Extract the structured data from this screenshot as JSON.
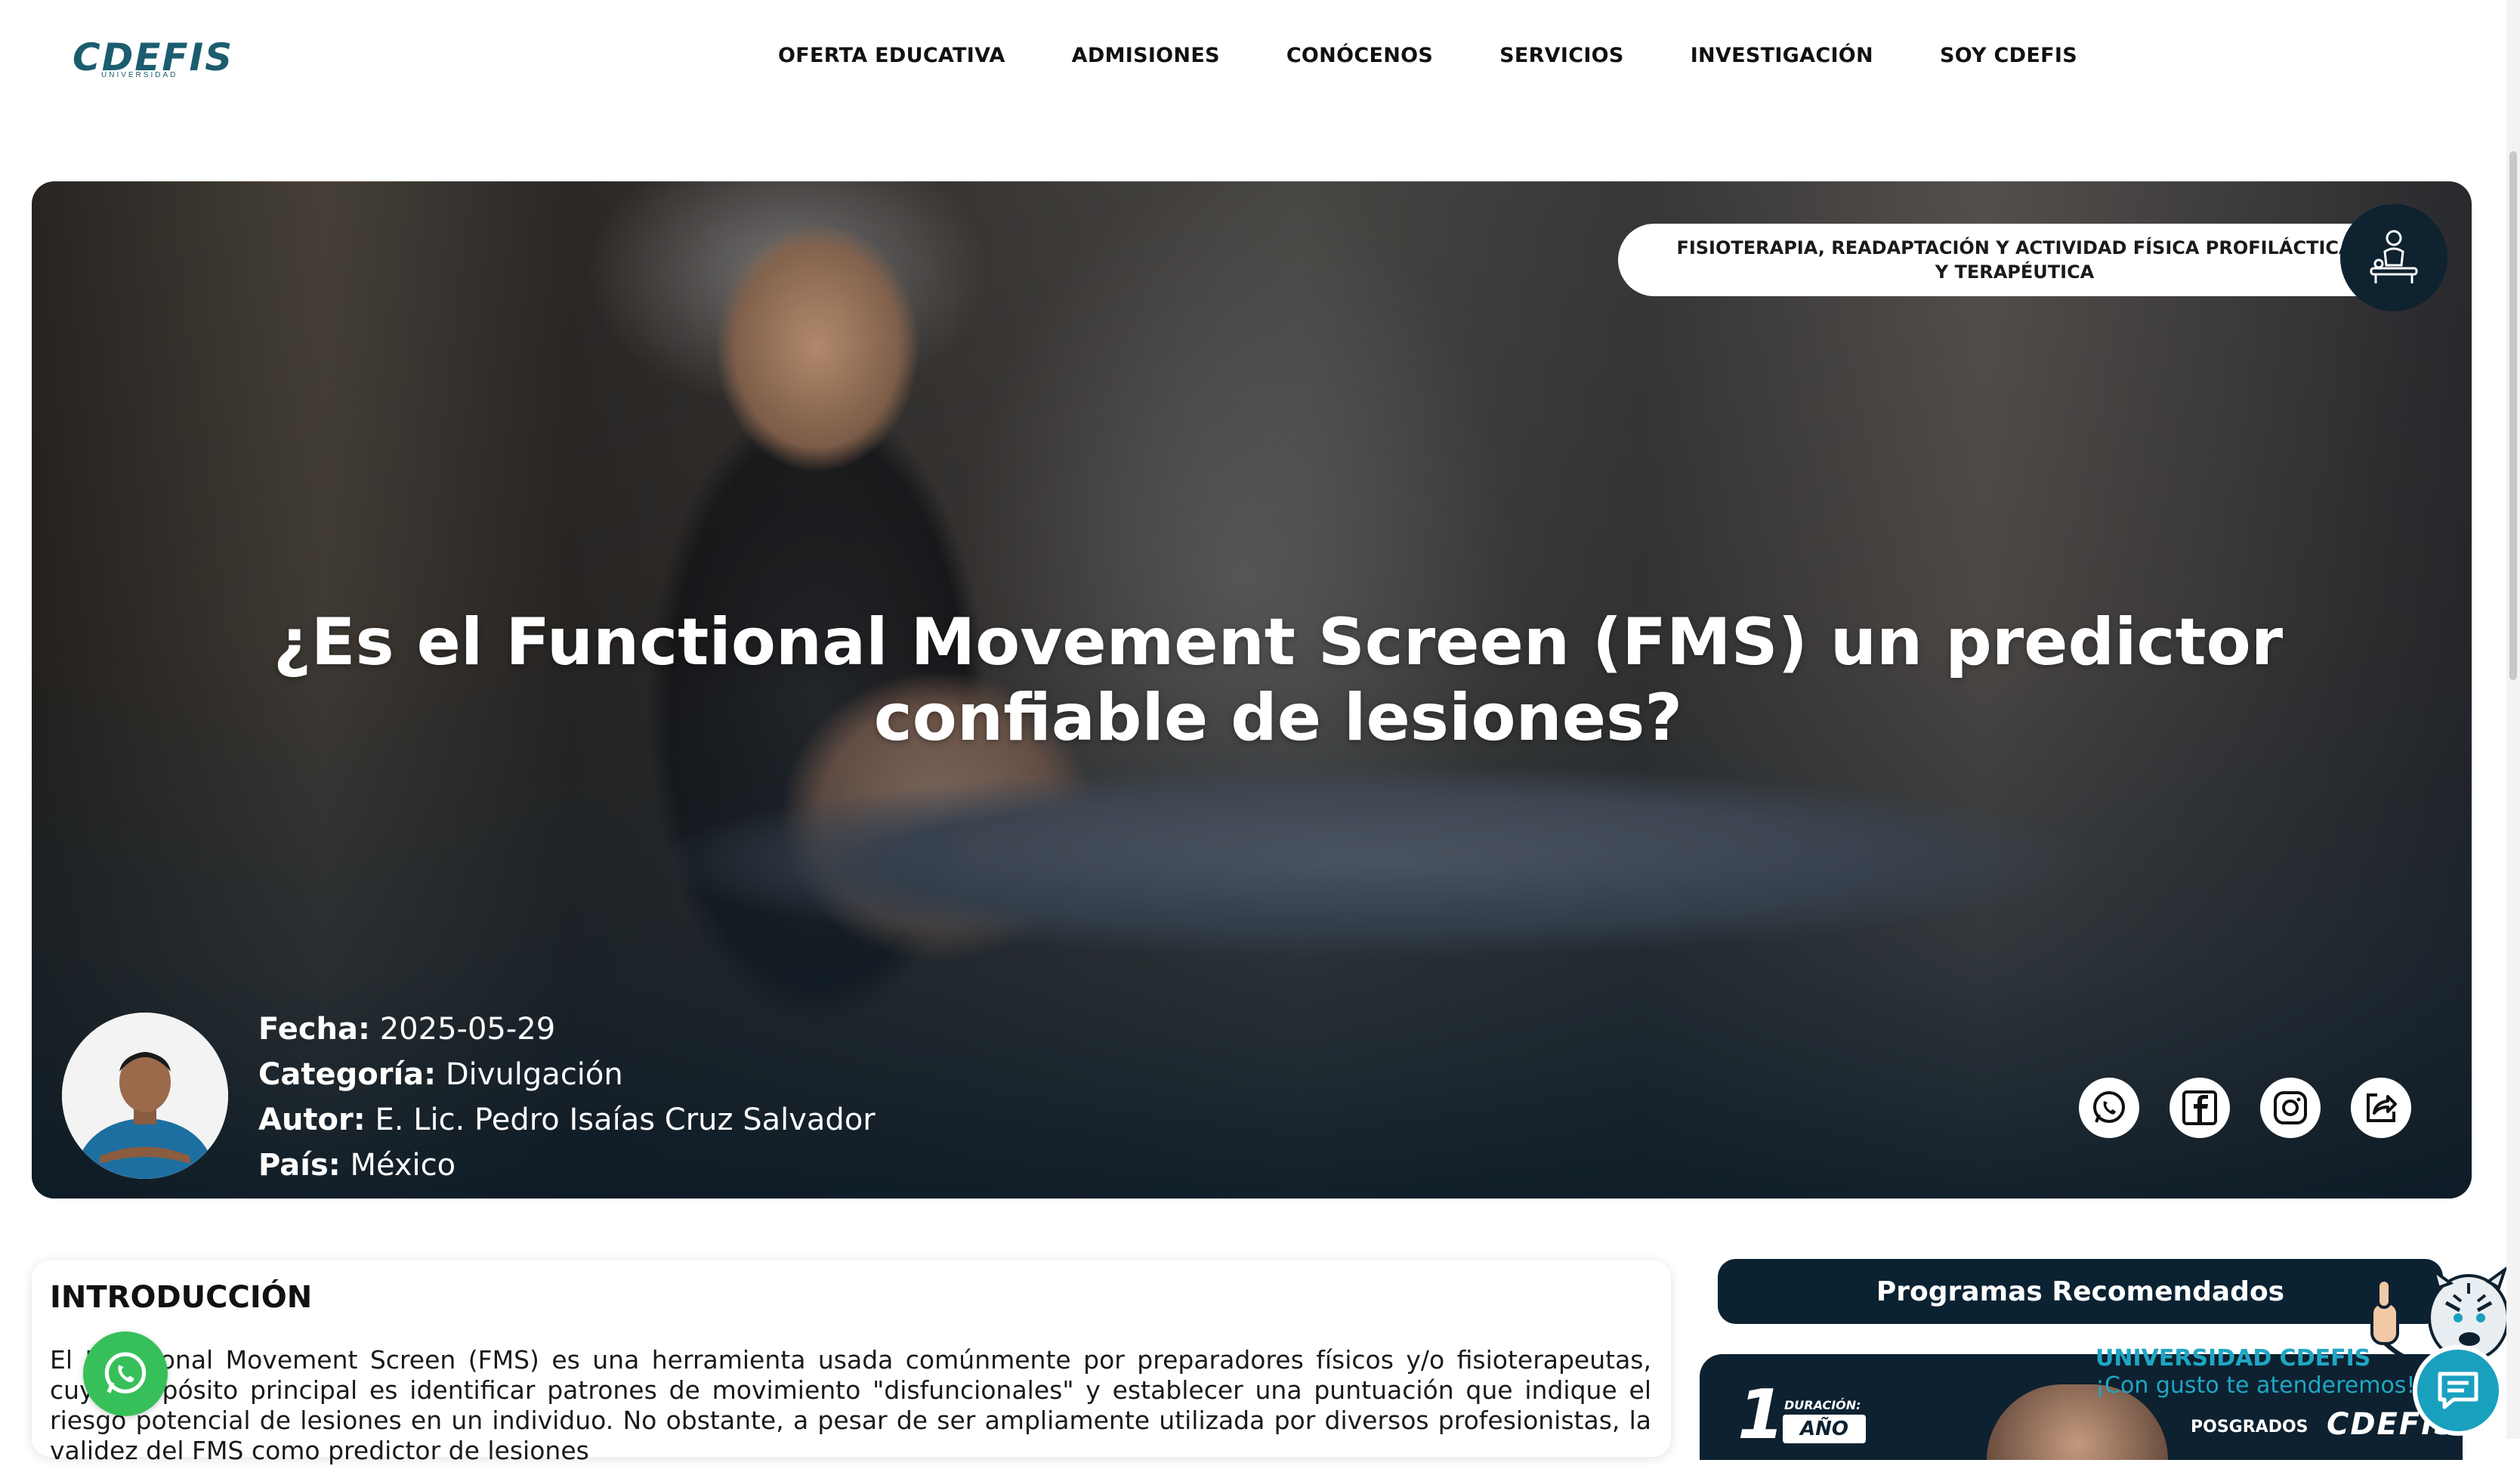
{
  "brand": {
    "logo": "CDEFIS",
    "logo_sub": "UNIVERSIDAD"
  },
  "nav": {
    "items": [
      {
        "label": "OFERTA EDUCATIVA"
      },
      {
        "label": "ADMISIONES"
      },
      {
        "label": "CONÓCENOS"
      },
      {
        "label": "SERVICIOS"
      },
      {
        "label": "INVESTIGACIÓN"
      },
      {
        "label": "SOY CDEFIS"
      }
    ]
  },
  "hero": {
    "category_pill": "FISIOTERAPIA, READAPTACIÓN Y ACTIVIDAD FÍSICA PROFILÁCTICA Y TERAPÉUTICA",
    "category_icon": "physiotherapy-icon",
    "title": "¿Es el Functional Movement Screen (FMS) un predictor confiable de lesiones?",
    "meta": {
      "date_label": "Fecha:",
      "date": "2025-05-29",
      "category_label": "Categoría:",
      "category": "Divulgación",
      "author_label": "Autor:",
      "author": "E. Lic. Pedro Isaías Cruz Salvador",
      "country_label": "País:",
      "country": "México"
    },
    "share_icons": [
      "whatsapp-icon",
      "facebook-icon",
      "instagram-icon",
      "share-icon"
    ]
  },
  "article": {
    "section_title": "INTRODUCCIÓN",
    "intro_text": "El Functional Movement Screen (FMS) es una herramienta usada comúnmente por preparadores físicos y/o fisioterapeutas, cuyo propósito principal es identificar patrones de movimiento \"disfuncionales\" y establecer una puntuación que indique el riesgo potencial de lesiones en un individuo. No obstante, a pesar de ser ampliamente utilizada por diversos profesionistas, la validez del FMS como predictor de lesiones"
  },
  "sidebar": {
    "recommended_title": "Programas Recomendados",
    "card": {
      "duration_label": "DURACIÓN:",
      "duration_number": "1",
      "duration_unit": "AÑO",
      "tag": "POSGRADOS",
      "brand": "CDEFIS"
    }
  },
  "chat": {
    "line1": "UNIVERSIDAD CDEFIS",
    "line2": "¡Con gusto te atenderemos!"
  },
  "colors": {
    "brand_teal": "#1b5d6f",
    "navy": "#0b2233",
    "whatsapp": "#37c05a",
    "chat": "#1aa0bf"
  }
}
